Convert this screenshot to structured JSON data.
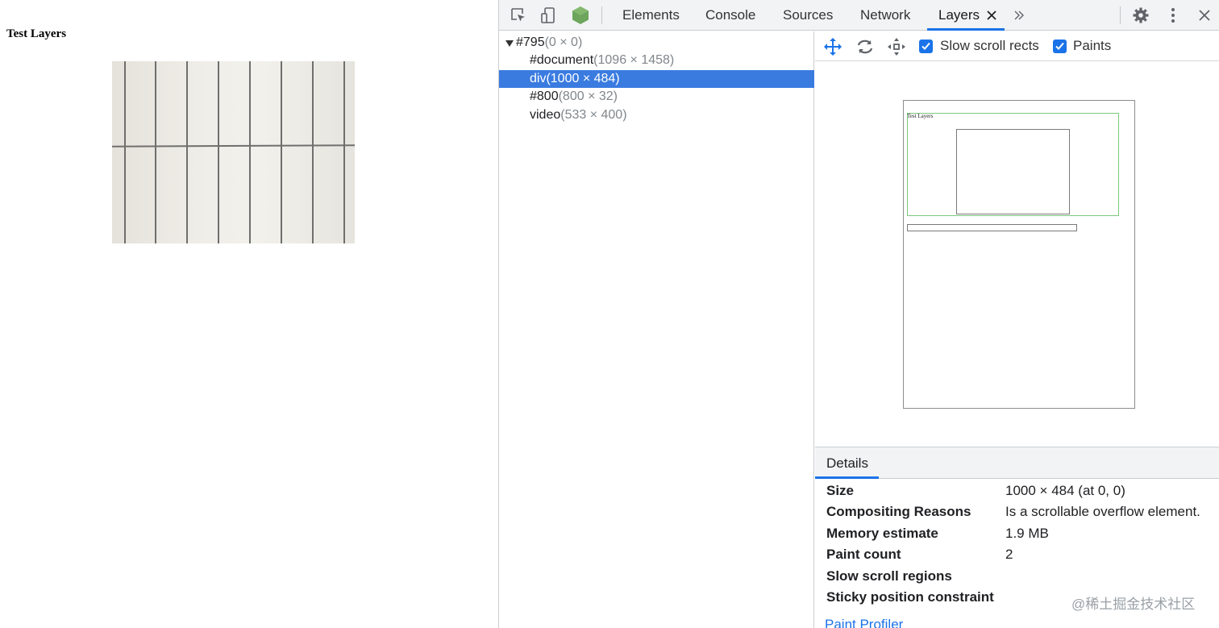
{
  "page": {
    "title": "Test Layers"
  },
  "devtools": {
    "tabs": [
      {
        "label": "Elements"
      },
      {
        "label": "Console"
      },
      {
        "label": "Sources"
      },
      {
        "label": "Network"
      },
      {
        "label": "Layers",
        "active": true
      }
    ],
    "more_tabs_icon": "chevron-double-right-icon",
    "accent_color": "#1a73e8",
    "selection_color": "#3a7be0"
  },
  "layer_tree": [
    {
      "name": "#795",
      "dims": "(0 × 0)",
      "expanded": true
    },
    {
      "name": "#document",
      "dims": "(1096 × 1458)"
    },
    {
      "name": "div",
      "dims": "(1000 × 484)",
      "selected": true
    },
    {
      "name": "#800",
      "dims": "(800 × 32)"
    },
    {
      "name": "video",
      "dims": "(533 × 400)"
    }
  ],
  "viewer": {
    "slow_scroll_label": "Slow scroll rects",
    "slow_scroll_checked": true,
    "paints_label": "Paints",
    "paints_checked": true,
    "canvas_title": "Test Layers"
  },
  "details": {
    "tab_label": "Details",
    "rows": [
      {
        "key": "Size",
        "value": "1000 × 484 (at 0, 0)"
      },
      {
        "key": "Compositing Reasons",
        "value": "Is a scrollable overflow element."
      },
      {
        "key": "Memory estimate",
        "value": "1.9 MB"
      },
      {
        "key": "Paint count",
        "value": "2"
      },
      {
        "key": "Slow scroll regions",
        "value": ""
      },
      {
        "key": "Sticky position constraint",
        "value": ""
      }
    ],
    "paint_profiler_link": "Paint Profiler"
  },
  "watermark": "@稀土掘金技术社区"
}
